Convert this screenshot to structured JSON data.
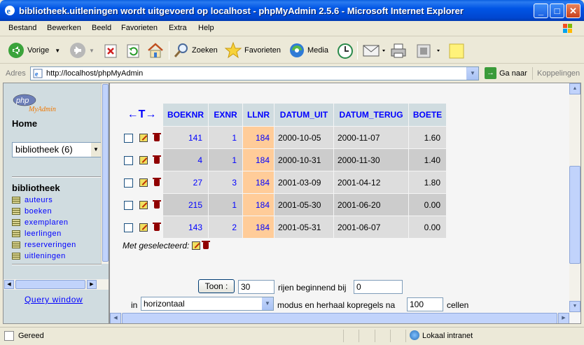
{
  "window": {
    "title": "bibliotheek.uitleningen wordt uitgevoerd op localhost - phpMyAdmin 2.5.6 - Microsoft Internet Explorer",
    "minimize": "_",
    "maximize": "□",
    "close": "✕"
  },
  "menu": [
    "Bestand",
    "Bewerken",
    "Beeld",
    "Favorieten",
    "Extra",
    "Help"
  ],
  "toolbar": {
    "back": "Vorige",
    "search": "Zoeken",
    "favorites": "Favorieten",
    "media": "Media"
  },
  "address": {
    "label": "Adres",
    "url": "http://localhost/phpMyAdmin",
    "go": "Ga naar",
    "links": "Koppelingen"
  },
  "left": {
    "logo_top": "php",
    "logo_bottom": "MyAdmin",
    "home": "Home",
    "db_select": "bibliotheek (6)",
    "db_name": "bibliotheek",
    "tables": [
      "auteurs",
      "boeken",
      "exemplaren",
      "leerlingen",
      "reserveringen",
      "uitleningen"
    ],
    "query_window": "Query window"
  },
  "results": {
    "arrows": "←T→",
    "columns": [
      "BOEKNR",
      "EXNR",
      "LLNR",
      "DATUM_UIT",
      "DATUM_TERUG",
      "BOETE"
    ],
    "rows": [
      [
        "141",
        "1",
        "184",
        "2000-10-05",
        "2000-11-07",
        "1.60"
      ],
      [
        "4",
        "1",
        "184",
        "2000-10-31",
        "2000-11-30",
        "1.40"
      ],
      [
        "27",
        "3",
        "184",
        "2001-03-09",
        "2001-04-12",
        "1.80"
      ],
      [
        "215",
        "1",
        "184",
        "2001-05-30",
        "2001-06-20",
        "0.00"
      ],
      [
        "143",
        "2",
        "184",
        "2001-05-31",
        "2001-06-07",
        "0.00"
      ]
    ],
    "with_selected": "Met geselecteerd:"
  },
  "navform": {
    "toon": "Toon :",
    "rows": "30",
    "rows_text": "rijen beginnend bij",
    "start": "0",
    "in": "in",
    "mode": "horizontaal",
    "mode_text": "modus en herhaal kopregels na",
    "repeat": "100",
    "cells": "cellen"
  },
  "status": {
    "text": "Gereed",
    "zone": "Lokaal intranet"
  }
}
